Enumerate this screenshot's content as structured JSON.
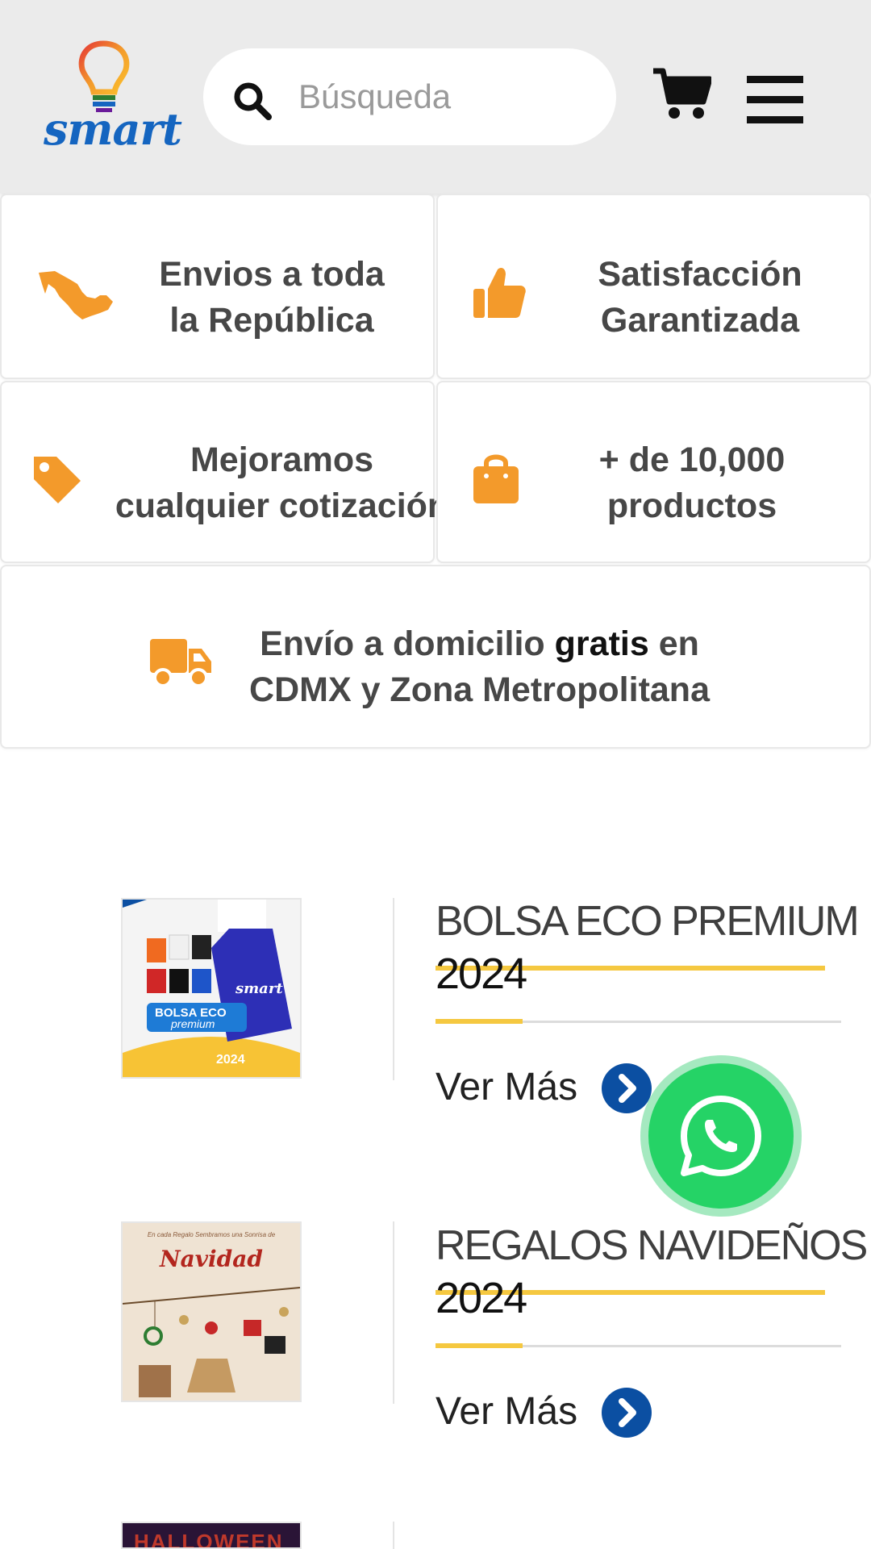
{
  "header": {
    "logo_text": "smart",
    "search_placeholder": "Búsqueda",
    "cart_icon": "cart-icon",
    "menu_icon": "hamburger-menu-icon",
    "background": "#ebebeb"
  },
  "features": [
    {
      "icon": "mexico-map-icon",
      "line1": "Envios a toda",
      "line2": "la República"
    },
    {
      "icon": "thumbs-up-icon",
      "line1": "Satisfacción",
      "line2": "Garantizada"
    },
    {
      "icon": "price-tag-icon",
      "line1": "Mejoramos",
      "line2": "cualquier cotización"
    },
    {
      "icon": "shopping-bag-icon",
      "line1": "+ de 10,000",
      "line2": "productos"
    }
  ],
  "shipping": {
    "icon": "delivery-truck-icon",
    "line1_pre": "Envío a domicilio ",
    "line1_bold": "gratis",
    "line1_post": " en",
    "line2": "CDMX y Zona Metropolitana"
  },
  "products": [
    {
      "title": "BOLSA ECO PREMIUM",
      "year": "2024",
      "cta": "Ver Más",
      "image_brand": "smart",
      "image_banner": "BOLSA ECO",
      "image_banner_sub": "premium",
      "image_year": "2024"
    },
    {
      "title": "REGALOS NAVIDEÑOS",
      "year": "2024",
      "cta": "Ver Más",
      "image_tagline": "En cada Regalo Sembramos una Sonrisa de",
      "image_title": "Navidad"
    }
  ],
  "next_product": {
    "image_text": "HALLOWEEN"
  },
  "whatsapp": {
    "icon": "whatsapp-icon"
  },
  "colors": {
    "accent_orange": "#f39a2b",
    "accent_yellow": "#f5c840",
    "link_blue": "#0b4fa2",
    "whatsapp_green": "#25d366"
  }
}
